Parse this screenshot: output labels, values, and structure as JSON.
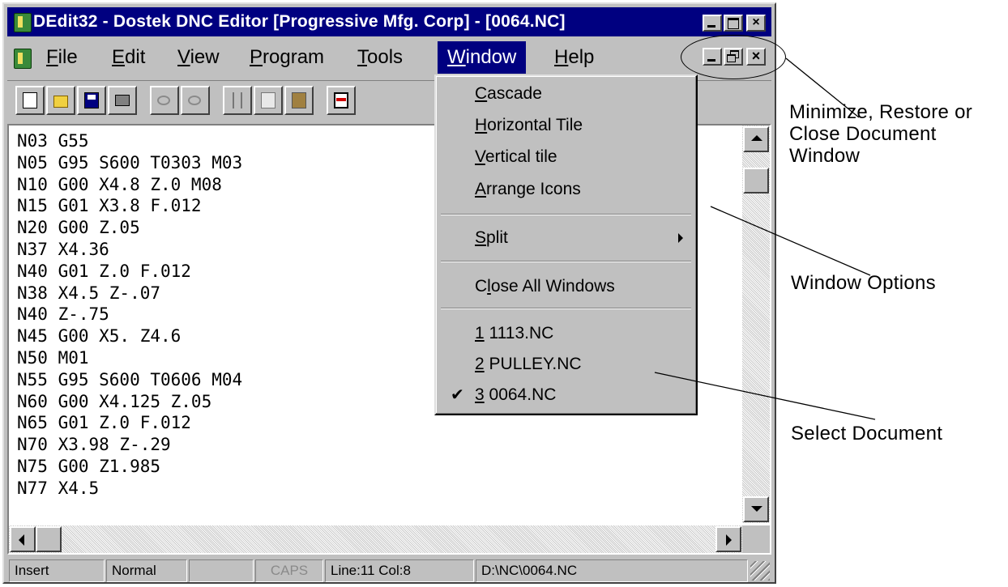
{
  "window": {
    "title": "DEdit32 - Dostek DNC Editor [Progressive Mfg. Corp] - [0064.NC]",
    "close_glyph": "×"
  },
  "menu": {
    "items": [
      {
        "u": "F",
        "rest": "ile"
      },
      {
        "u": "E",
        "rest": "dit"
      },
      {
        "u": "V",
        "rest": "iew"
      },
      {
        "u": "P",
        "rest": "rogram"
      },
      {
        "u": "T",
        "rest": "ools"
      },
      {
        "u": "W",
        "rest": "indow"
      },
      {
        "u": "H",
        "rest": "elp"
      }
    ]
  },
  "code_lines": [
    "N03 G55",
    "N05 G95 S600 T0303 M03",
    "N10 G00 X4.8 Z.0 M08",
    "N15 G01 X3.8 F.012",
    "N20 G00 Z.05",
    "N37 X4.36",
    "N40 G01 Z.0 F.012",
    "N38 X4.5 Z-.07",
    "N40 Z-.75",
    "N45 G00 X5. Z4.6",
    "N50 M01",
    "N55 G95 S600 T0606 M04",
    "N60 G00 X4.125 Z.05",
    "N65 G01 Z.0 F.012",
    "N70 X3.98 Z-.29",
    "N75 G00 Z1.985",
    "N77 X4.5"
  ],
  "status": {
    "mode": "Insert",
    "view": "Normal",
    "blank": "",
    "caps": "CAPS",
    "position": "Line:11 Col:8",
    "path": "D:\\NC\\0064.NC"
  },
  "window_menu": {
    "cascade": {
      "u": "C",
      "rest": "ascade"
    },
    "horizontal_tile": {
      "u": "H",
      "rest": "orizontal Tile"
    },
    "vertical_tile": {
      "u": "V",
      "rest": "ertical tile"
    },
    "arrange_icons": {
      "u": "A",
      "rest": "rrange Icons"
    },
    "split": {
      "u": "S",
      "rest": "plit"
    },
    "close_all": {
      "pre": "C",
      "u": "l",
      "rest": "ose All Windows"
    },
    "doc1": {
      "u": "1",
      "rest": " 1113.NC"
    },
    "doc2": {
      "u": "2",
      "rest": " PULLEY.NC"
    },
    "doc3": {
      "u": "3",
      "rest": " 0064.NC",
      "check": "✔"
    }
  },
  "annotations": {
    "min_restore_close": [
      "Minimize, Restore or",
      "Close Document",
      "Window"
    ],
    "window_options": "Window Options",
    "select_document": "Select Document"
  },
  "colors": {
    "titlebar": "#000080",
    "chrome": "#c0c0c0",
    "editor_bg": "#ffffff"
  }
}
